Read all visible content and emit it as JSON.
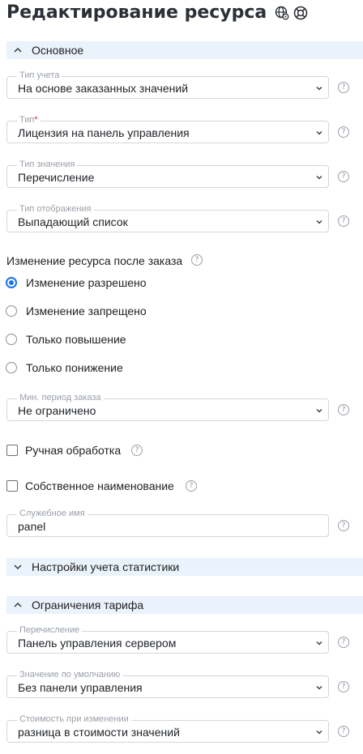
{
  "page": {
    "title": "Редактирование ресурса"
  },
  "sections": {
    "basic": {
      "label": "Основное",
      "expanded": true
    },
    "stats": {
      "label": "Настройки учета статистики",
      "expanded": false
    },
    "tariff": {
      "label": "Ограничения тарифа",
      "expanded": true
    }
  },
  "fields": {
    "accounting_type": {
      "label": "Тип учета",
      "value": "На основе заказанных значений"
    },
    "type": {
      "label": "Тип",
      "required_mark": "*",
      "value": "Лицензия на панель управления"
    },
    "value_type": {
      "label": "Тип значения",
      "value": "Перечисление"
    },
    "display_type": {
      "label": "Тип отображения",
      "value": "Выпадающий список"
    },
    "min_order_period": {
      "label": "Мин. период заказа",
      "value": "Не ограничено"
    },
    "service_name": {
      "label": "Служебное имя",
      "value": "panel"
    },
    "enumeration": {
      "label": "Перечисление",
      "value": "Панель управления сервером"
    },
    "default_value": {
      "label": "Значение по умолчанию",
      "value": "Без панели управления"
    },
    "change_cost": {
      "label": "Стоимость при изменении",
      "value": "разница в стоимости значений"
    }
  },
  "change_after_order": {
    "label": "Изменение ресурса после заказа",
    "options": [
      {
        "label": "Изменение разрешено",
        "selected": true
      },
      {
        "label": "Изменение запрещено",
        "selected": false
      },
      {
        "label": "Только повышение",
        "selected": false
      },
      {
        "label": "Только понижение",
        "selected": false
      }
    ]
  },
  "checkboxes": {
    "manual_processing": {
      "label": "Ручная обработка",
      "checked": false
    },
    "own_name": {
      "label": "Собственное наименование",
      "checked": false
    }
  },
  "help_glyph": "?",
  "icons": {
    "title_icons": [
      "globe-settings-icon",
      "lifebuoy-icon"
    ],
    "section_toggle": "chevron-icon",
    "dropdown": "chevron-down-icon",
    "help": "question-circle-icon"
  },
  "colors": {
    "accent": "#1a73e8",
    "section_bg": "#eaf2fb",
    "required": "#e0303a",
    "border": "#d3d6db",
    "muted_label": "#9aa0a8"
  }
}
